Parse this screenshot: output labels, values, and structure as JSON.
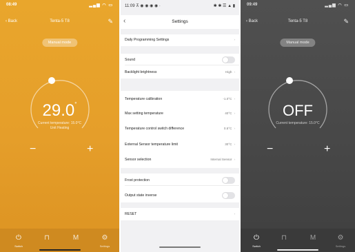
{
  "left": {
    "status": {
      "time": "08:49",
      "icons": "▂▄▆ ◠ ▭"
    },
    "nav": {
      "back": "‹ Back",
      "title": "Tenta-5 T8",
      "edit": "✎"
    },
    "mode": "Manual mode",
    "temperature": "29.0",
    "unit": "°",
    "current_label": "Current temperature: 15.0°C",
    "current_sub": "Unit Heating",
    "minus": "−",
    "plus": "+",
    "setpoint_fraction": 0.45,
    "tabs": [
      {
        "icon": "power-icon",
        "glyph": "⏻",
        "label": "Switch"
      },
      {
        "icon": "lock-icon",
        "glyph": "⊓",
        "label": ""
      },
      {
        "icon": "mode-icon",
        "glyph": "M",
        "label": ""
      },
      {
        "icon": "gear-icon",
        "glyph": "⚙",
        "label": "Settings"
      }
    ]
  },
  "settings": {
    "status": {
      "time": "11:09 ⊼ ◉ ◉ ◉ ◉ ·",
      "icons": "✱ ✱ ☰ ▲ ▮"
    },
    "title": "Settings",
    "back": "‹",
    "rows": [
      {
        "label": "Daily Programming Settings",
        "value": "",
        "type": "link"
      },
      {
        "label": "Sound",
        "value": "",
        "type": "toggle"
      },
      {
        "label": "Backlight brightness",
        "value": "High",
        "type": "link"
      },
      {
        "label": "Temperature calibration",
        "value": "-1.0°C",
        "type": "link"
      },
      {
        "label": "Max setting temperature",
        "value": "40°C",
        "type": "link"
      },
      {
        "label": "Temperature control switch difference",
        "value": "0.5°C",
        "type": "link"
      },
      {
        "label": "External Sensor temperature limit",
        "value": "30°C",
        "type": "link"
      },
      {
        "label": "Sensor selection",
        "value": "Internal Sensor",
        "type": "link"
      },
      {
        "label": "Frost protection",
        "value": "",
        "type": "toggle"
      },
      {
        "label": "Output state inverse",
        "value": "",
        "type": "toggle"
      },
      {
        "label": "RESET",
        "value": "",
        "type": "link"
      }
    ]
  },
  "right": {
    "status": {
      "time": "09:49",
      "icons": "▂▄▆ ◠ ▭"
    },
    "nav": {
      "back": "‹ Back",
      "title": "Tenta-5 T8",
      "edit": "✎"
    },
    "mode": "Manual mode",
    "state": "OFF",
    "current_label": "Current temperature: 15.0°C",
    "minus": "−",
    "plus": "+",
    "tabs": [
      {
        "icon": "power-icon",
        "glyph": "⏻",
        "label": "Switch"
      },
      {
        "icon": "lock-icon",
        "glyph": "⊓",
        "label": ""
      },
      {
        "icon": "mode-icon",
        "glyph": "M",
        "label": ""
      },
      {
        "icon": "gear-icon",
        "glyph": "⚙",
        "label": "Settings"
      }
    ]
  },
  "colors": {
    "accent": "#e5a02a",
    "dark": "#4a4a4a",
    "settings_bg": "#f1f1f3"
  }
}
